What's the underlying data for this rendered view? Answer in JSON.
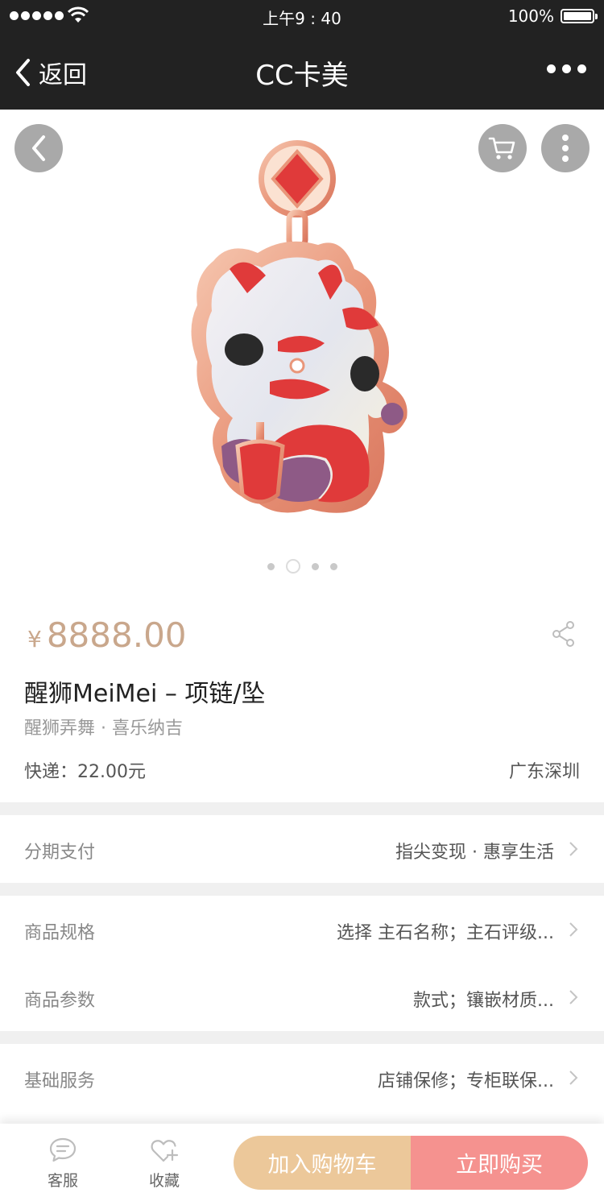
{
  "status_bar": {
    "time": "上午9 : 40",
    "battery": "100%"
  },
  "nav": {
    "back_label": "返回",
    "title": "CC卡美"
  },
  "gallery": {
    "image_count": 4,
    "active_index": 1
  },
  "product": {
    "currency": "¥",
    "price": "8888.00",
    "title": "醒狮MeiMei – 项链/坠",
    "subtitle": "醒狮弄舞 · 喜乐纳吉",
    "shipping": "快递：22.00元",
    "location": "广东深圳"
  },
  "rows": {
    "installment": {
      "label": "分期支付",
      "value": "指尖变现 · 惠享生活"
    },
    "spec": {
      "label": "商品规格",
      "value": "选择 主石名称；主石评级..."
    },
    "params": {
      "label": "商品参数",
      "value": "款式；镶嵌材质..."
    },
    "service": {
      "label": "基础服务",
      "value": "店铺保修；专柜联保..."
    }
  },
  "bottom": {
    "service_label": "客服",
    "favorite_label": "收藏",
    "add_cart_label": "加入购物车",
    "buy_label": "立即购买"
  },
  "colors": {
    "nav_bg": "#222222",
    "price": "#c9a78c",
    "add_cart_bg": "#ecc89a",
    "buy_bg": "#f5928f",
    "divider": "#f0f0f0"
  }
}
